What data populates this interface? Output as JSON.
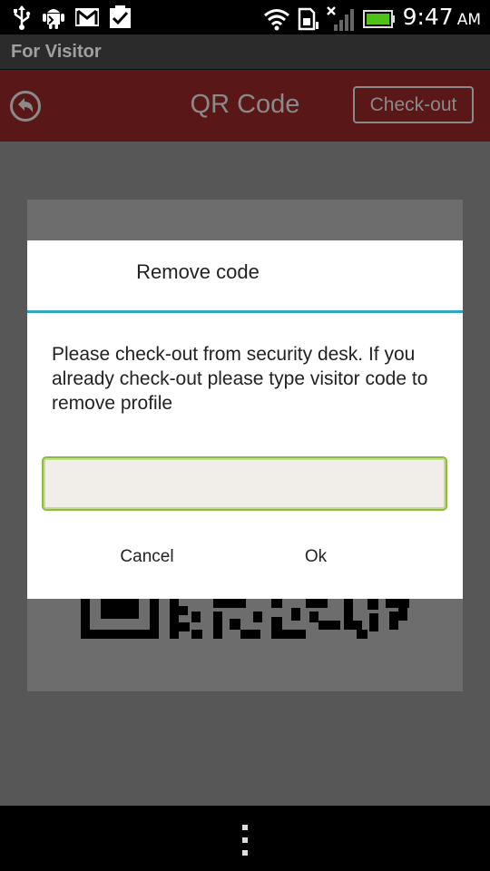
{
  "status_bar": {
    "time": "9:47",
    "ampm": "AM",
    "icons": [
      "usb-icon",
      "android-debug-icon",
      "gmail-icon",
      "task-check-icon",
      "wifi-icon",
      "sd-card-icon",
      "no-signal-icon",
      "battery-icon"
    ]
  },
  "app": {
    "title": "For Visitor"
  },
  "header": {
    "title": "QR Code",
    "checkout_label": "Check-out",
    "color": "#5a1718"
  },
  "dialog": {
    "title": "Remove code",
    "message": "Please check-out from security desk. If you already check-out please type visitor code to remove profile",
    "input_value": "",
    "input_placeholder": "",
    "cancel_label": "Cancel",
    "ok_label": "Ok",
    "accent_color": "#2ea5c4"
  }
}
